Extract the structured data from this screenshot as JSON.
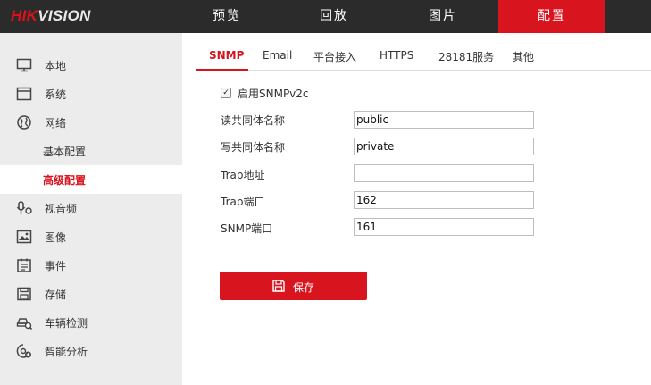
{
  "brand": {
    "part1": "HIK",
    "part2": "VISION"
  },
  "nav": [
    "预览",
    "回放",
    "图片",
    "配置"
  ],
  "sidebar": {
    "items": [
      {
        "label": "本地",
        "icon": "monitor-icon"
      },
      {
        "label": "系统",
        "icon": "system-icon"
      },
      {
        "label": "网络",
        "icon": "globe-icon"
      },
      {
        "label": "基本配置"
      },
      {
        "label": "高级配置"
      },
      {
        "label": "视音频",
        "icon": "audio-video-icon"
      },
      {
        "label": "图像",
        "icon": "image-icon"
      },
      {
        "label": "事件",
        "icon": "event-icon"
      },
      {
        "label": "存储",
        "icon": "storage-icon"
      },
      {
        "label": "车辆检测",
        "icon": "vehicle-detect-icon"
      },
      {
        "label": "智能分析",
        "icon": "smart-analysis-icon"
      }
    ],
    "active": "高级配置"
  },
  "tabs": [
    "SNMP",
    "Email",
    "平台接入",
    "HTTPS",
    "28181服务",
    "其他"
  ],
  "active_tab": "SNMP",
  "form": {
    "enable_label": "启用SNMPv2c",
    "enable_checked": true,
    "rows": [
      {
        "label": "读共同体名称",
        "value": "public"
      },
      {
        "label": "写共同体名称",
        "value": "private"
      },
      {
        "label": "Trap地址",
        "value": ""
      },
      {
        "label": "Trap端口",
        "value": "162"
      },
      {
        "label": "SNMP端口",
        "value": "161"
      }
    ],
    "save_label": "保存"
  },
  "colors": {
    "accent": "#d8141f",
    "topbar": "#2b2b2b",
    "sidebar": "#ececec"
  }
}
